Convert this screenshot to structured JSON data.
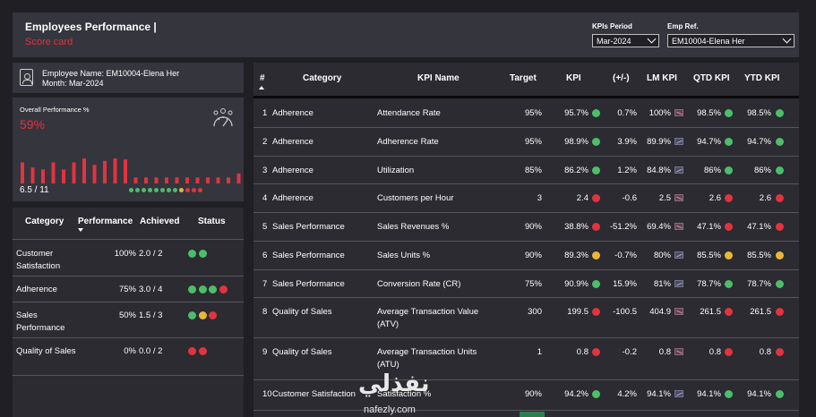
{
  "header": {
    "title": "Employees Performance |",
    "subtitle": "Score card",
    "kpi_period_label": "KPIs Period",
    "kpi_period_value": "Mar-2024",
    "emp_ref_label": "Emp Ref.",
    "emp_ref_value": "EM10004-Elena Her"
  },
  "employee": {
    "name_line": "Employee Name: EM10004-Elena Her",
    "month_line": "Month: Mar-2024"
  },
  "overall": {
    "label": "Overall Performance %",
    "value": "59%",
    "count": "6.5 / 11",
    "bar_levels": [
      0.42,
      0.32,
      0.28,
      0.42,
      0.28,
      0.42,
      0.5,
      0.37,
      0.45,
      0.5,
      0.48,
      0.12,
      0.12,
      0.12,
      0.12,
      0.12,
      0.12,
      0.12,
      0.12,
      0.12,
      0.12,
      0.2
    ],
    "bar_colors": [
      "red",
      "red",
      "red",
      "red",
      "red",
      "red",
      "red",
      "red",
      "red",
      "red",
      "red",
      "red",
      "red",
      "red",
      "red",
      "red",
      "red",
      "red",
      "red",
      "red",
      "red",
      "red"
    ],
    "status_dots": [
      "green",
      "green",
      "green",
      "green",
      "green",
      "green",
      "green",
      "green",
      "yellow",
      "red",
      "red",
      "red"
    ]
  },
  "category_table": {
    "headers": [
      "Category",
      "Performance",
      "Achieved",
      "Status"
    ],
    "rows": [
      {
        "category": "Customer Satisfaction",
        "performance": "100%",
        "achieved": "2.0 / 2",
        "status": [
          "green",
          "green"
        ]
      },
      {
        "category": "Adherence",
        "performance": "75%",
        "achieved": "3.0 / 4",
        "status": [
          "green",
          "green",
          "green",
          "red"
        ]
      },
      {
        "category": "Sales Performance",
        "performance": "50%",
        "achieved": "1.5 / 3",
        "status": [
          "green",
          "yellow",
          "red"
        ]
      },
      {
        "category": "Quality of Sales",
        "performance": "0%",
        "achieved": "0.0 / 2",
        "status": [
          "red",
          "red"
        ]
      }
    ]
  },
  "kpi_table": {
    "headers": [
      "#",
      "Category",
      "KPI Name",
      "Target",
      "KPI",
      "(+/-)",
      "LM KPI",
      "QTD KPI",
      "YTD KPI"
    ],
    "rows": [
      {
        "num": "1",
        "category": "Adherence",
        "kpi_name": "Attendance Rate",
        "target": "95%",
        "kpi": "95.7%",
        "kpi_s": "green",
        "diff": "0.7%",
        "lm": "100%",
        "lm_t": "dn",
        "qtd": "98.5%",
        "qtd_s": "green",
        "ytd": "98.5%",
        "ytd_s": "green"
      },
      {
        "num": "2",
        "category": "Adherence",
        "kpi_name": "Adherence Rate",
        "target": "95%",
        "kpi": "98.9%",
        "kpi_s": "green",
        "diff": "3.9%",
        "lm": "89.9%",
        "lm_t": "up",
        "qtd": "94.7%",
        "qtd_s": "green",
        "ytd": "94.7%",
        "ytd_s": "green"
      },
      {
        "num": "3",
        "category": "Adherence",
        "kpi_name": "Utilization",
        "target": "85%",
        "kpi": "86.2%",
        "kpi_s": "green",
        "diff": "1.2%",
        "lm": "84.8%",
        "lm_t": "up",
        "qtd": "86%",
        "qtd_s": "green",
        "ytd": "86%",
        "ytd_s": "green"
      },
      {
        "num": "4",
        "category": "Adherence",
        "kpi_name": "Customers per Hour",
        "target": "3",
        "kpi": "2.4",
        "kpi_s": "red",
        "diff": "-0.6",
        "lm": "2.5",
        "lm_t": "dn",
        "qtd": "2.6",
        "qtd_s": "red",
        "ytd": "2.6",
        "ytd_s": "red"
      },
      {
        "num": "5",
        "category": "Sales Performance",
        "kpi_name": "Sales Revenues %",
        "target": "90%",
        "kpi": "38.8%",
        "kpi_s": "red",
        "diff": "-51.2%",
        "lm": "69.4%",
        "lm_t": "dn",
        "qtd": "47.1%",
        "qtd_s": "red",
        "ytd": "47.1%",
        "ytd_s": "red"
      },
      {
        "num": "6",
        "category": "Sales Performance",
        "kpi_name": "Sales Units %",
        "target": "90%",
        "kpi": "89.3%",
        "kpi_s": "yellow",
        "diff": "-0.7%",
        "lm": "80%",
        "lm_t": "up",
        "qtd": "85.5%",
        "qtd_s": "yellow",
        "ytd": "85.5%",
        "ytd_s": "yellow"
      },
      {
        "num": "7",
        "category": "Sales Performance",
        "kpi_name": "Conversion Rate (CR)",
        "target": "75%",
        "kpi": "90.9%",
        "kpi_s": "green",
        "diff": "15.9%",
        "lm": "81%",
        "lm_t": "up",
        "qtd": "78.7%",
        "qtd_s": "green",
        "ytd": "78.7%",
        "ytd_s": "green"
      },
      {
        "num": "8",
        "category": "Quality of Sales",
        "kpi_name": "Average Transaction Value (ATV)",
        "target": "300",
        "kpi": "199.5",
        "kpi_s": "red",
        "diff": "-100.5",
        "lm": "404.9",
        "lm_t": "dn",
        "qtd": "261.5",
        "qtd_s": "red",
        "ytd": "261.5",
        "ytd_s": "red"
      },
      {
        "num": "9",
        "category": "Quality of Sales",
        "kpi_name": "Average Transaction Units (ATU)",
        "target": "1",
        "kpi": "0.8",
        "kpi_s": "red",
        "diff": "-0.2",
        "lm": "0.8",
        "lm_t": "dn",
        "qtd": "0.8",
        "qtd_s": "red",
        "ytd": "0.8",
        "ytd_s": "red"
      },
      {
        "num": "10",
        "category": "Customer Satisfaction",
        "kpi_name": "Satisfaction %",
        "target": "90%",
        "kpi": "94.2%",
        "kpi_s": "green",
        "diff": "4.2%",
        "lm": "94.1%",
        "lm_t": "up",
        "qtd": "94.1%",
        "qtd_s": "green",
        "ytd": "94.1%",
        "ytd_s": "green"
      }
    ]
  },
  "watermark": {
    "arabic": "نفذلي",
    "latin": "nafezly.com"
  },
  "colors": {
    "red": "#e0343f",
    "green": "#4dbd6a",
    "yellow": "#e9b63a",
    "panel": "#35353d",
    "table": "#2b2b31"
  }
}
